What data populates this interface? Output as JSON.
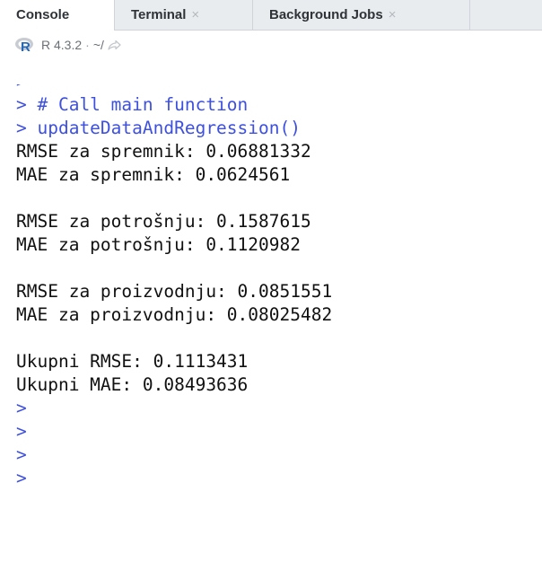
{
  "tabs": [
    {
      "label": "Console",
      "active": true
    },
    {
      "label": "Terminal",
      "close": "×"
    },
    {
      "label": "Background Jobs",
      "close": "×"
    }
  ],
  "subbar": {
    "r_version": "R 4.3.2",
    "separator": "·",
    "working_dir": "~/",
    "icons": [
      "r-logo-icon",
      "goto-directory-icon"
    ]
  },
  "console": {
    "prompt_symbol": ">",
    "lines": [
      {
        "kind": "input",
        "text": "> # Call main function"
      },
      {
        "kind": "input",
        "text": "> updateDataAndRegression()"
      },
      {
        "kind": "output",
        "text": "RMSE za spremnik: 0.06881332"
      },
      {
        "kind": "output",
        "text": "MAE za spremnik: 0.0624561"
      },
      {
        "kind": "blank",
        "text": ""
      },
      {
        "kind": "output",
        "text": "RMSE za potrošnju: 0.1587615"
      },
      {
        "kind": "output",
        "text": "MAE za potrošnju: 0.1120982"
      },
      {
        "kind": "blank",
        "text": ""
      },
      {
        "kind": "output",
        "text": "RMSE za proizvodnju: 0.0851551"
      },
      {
        "kind": "output",
        "text": "MAE za proizvodnju: 0.08025482"
      },
      {
        "kind": "blank",
        "text": ""
      },
      {
        "kind": "output",
        "text": "Ukupni RMSE: 0.1113431"
      },
      {
        "kind": "output",
        "text": "Ukupni MAE: 0.08493636"
      },
      {
        "kind": "input",
        "text": ">"
      },
      {
        "kind": "input",
        "text": ">"
      },
      {
        "kind": "input",
        "text": ">"
      },
      {
        "kind": "input",
        "text": ">"
      }
    ]
  },
  "colors": {
    "input": "#3d50e0",
    "output": "#111111",
    "r_logo_blue": "#2468b6"
  }
}
